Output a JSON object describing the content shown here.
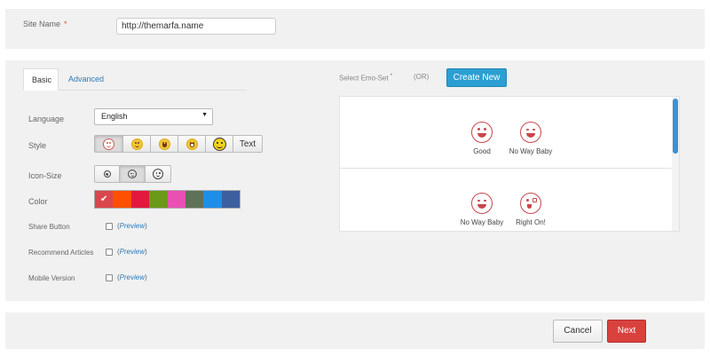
{
  "site": {
    "label": "Site Name",
    "required_mark": "*",
    "value": "http://themarfa.name"
  },
  "tabs": [
    {
      "label": "Basic",
      "active": true
    },
    {
      "label": "Advanced",
      "active": false
    }
  ],
  "form": {
    "language_label": "Language",
    "language_value": "English",
    "style_label": "Style",
    "style_text_button": "Text",
    "icon_size_label": "Icon-Size",
    "color_label": "Color",
    "colors": [
      "#d9474c",
      "#ff4f00",
      "#e3183e",
      "#6a9a17",
      "#ea4fb3",
      "#5d7256",
      "#1e8fe8",
      "#3c5f9f"
    ],
    "selected_color_mark": "✔",
    "options": [
      {
        "label": "Share Button",
        "checked": false,
        "preview": "Preview"
      },
      {
        "label": "Recommend Articles",
        "checked": false,
        "preview": "Preview"
      },
      {
        "label": "Mobile Version",
        "checked": false,
        "preview": "Preview"
      }
    ]
  },
  "emo": {
    "label": "Select Emo-Set",
    "required_mark": "*",
    "or": "(OR)",
    "create_button": "Create New",
    "sets": [
      {
        "items": [
          "Good",
          "No Way Baby"
        ]
      },
      {
        "items": [
          "No Way Baby",
          "Right On!"
        ]
      }
    ]
  },
  "footer": {
    "cancel": "Cancel",
    "next": "Next"
  }
}
